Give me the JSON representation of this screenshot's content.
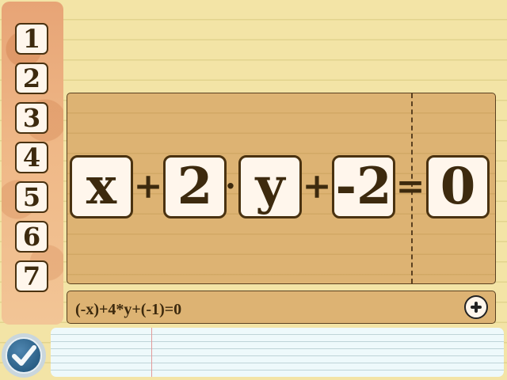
{
  "levels": [
    "1",
    "2",
    "3",
    "4",
    "5",
    "6",
    "7"
  ],
  "equation": {
    "tiles": [
      "x",
      "2",
      "y",
      "-2",
      "0"
    ],
    "operators": [
      "+",
      "·",
      "+",
      "="
    ]
  },
  "formula_text": "(-x)+4*y+(-1)=0",
  "colors": {
    "background": "#f3e4a6",
    "board": "#ddb373",
    "tile": "#fff6ec",
    "ink": "#3d2a0e",
    "check_button": "#2a5f86",
    "sidebar": "#efb887"
  },
  "icons": {
    "add": "plus-circle-icon",
    "submit": "checkmark-icon"
  }
}
